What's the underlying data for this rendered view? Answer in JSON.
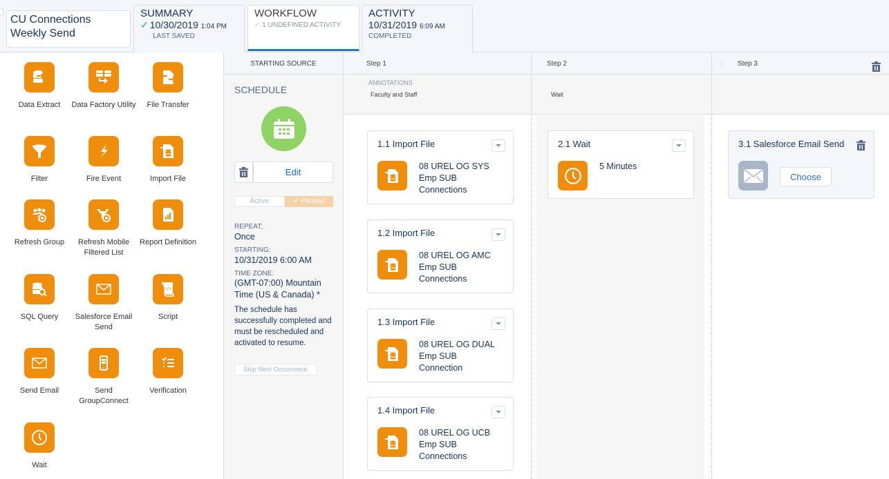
{
  "header": {
    "title": "CU Connections Weekly Send",
    "tabs": [
      {
        "title": "SUMMARY",
        "date": "10/30/2019",
        "time": "1:04 PM",
        "sub": "LAST SAVED",
        "icon": "check-icon"
      },
      {
        "title": "WORKFLOW",
        "sub": "1 UNDEFINED ACTIVITY",
        "icon": "undefined-activity-icon",
        "active": true
      },
      {
        "title": "ACTIVITY",
        "date": "10/31/2019",
        "time": "6:09 AM",
        "sub": "COMPLETED"
      }
    ]
  },
  "palette": {
    "items": [
      {
        "label": "Data Extract",
        "icon": "data-extract-icon"
      },
      {
        "label": "Data Factory Utility",
        "icon": "data-factory-icon"
      },
      {
        "label": "File Transfer",
        "icon": "file-transfer-icon"
      },
      {
        "label": "Filter",
        "icon": "filter-icon"
      },
      {
        "label": "Fire Event",
        "icon": "lightning-icon"
      },
      {
        "label": "Import File",
        "icon": "import-file-icon"
      },
      {
        "label": "Refresh Group",
        "icon": "refresh-group-icon"
      },
      {
        "label": "Refresh Mobile Filtered List",
        "icon": "refresh-mobile-list-icon"
      },
      {
        "label": "Report Definition",
        "icon": "report-icon"
      },
      {
        "label": "SQL Query",
        "icon": "sql-query-icon"
      },
      {
        "label": "Salesforce Email Send",
        "icon": "email-icon"
      },
      {
        "label": "Script",
        "icon": "script-icon"
      },
      {
        "label": "Send Email",
        "icon": "email-icon"
      },
      {
        "label": "Send GroupConnect",
        "icon": "mobile-icon"
      },
      {
        "label": "Verification",
        "icon": "checklist-icon"
      },
      {
        "label": "Wait",
        "icon": "clock-icon"
      }
    ]
  },
  "starting_source": {
    "header": "STARTING SOURCE",
    "title": "SCHEDULE",
    "edit_label": "Edit",
    "toggle": {
      "active_label": "Active",
      "paused_label": "Paused",
      "selected": "Paused"
    },
    "repeat_label": "REPEAT:",
    "repeat_value": "Once",
    "starting_label": "STARTING:",
    "starting_value": "10/31/2019 6:00 AM",
    "timezone_label": "TIME ZONE:",
    "timezone_value": "(GMT-07:00) Mountain Time (US & Canada) *",
    "message": "The schedule has successfully completed and must be rescheduled and activated to resume.",
    "skip_label": "Skip Next Occurrence"
  },
  "steps": [
    {
      "label": "Step 1",
      "annotations_label": "ANNOTATIONS",
      "annotation": "Faculty and Staff",
      "activities": [
        {
          "title": "1.1 Import File",
          "text": "08 UREL OG SYS Emp SUB Connections"
        },
        {
          "title": "1.2 Import File",
          "text": "08 UREL OG AMC Emp SUB Connections"
        },
        {
          "title": "1.3 Import File",
          "text": "08 UREL OG DUAL Emp SUB Connection"
        },
        {
          "title": "1.4 Import File",
          "text": "08 UREL OG UCB Emp SUB Connections"
        }
      ]
    },
    {
      "label": "Step 2",
      "annotation": "Wait",
      "activities": [
        {
          "title": "2.1 Wait",
          "text": "5 Minutes"
        }
      ]
    },
    {
      "label": "Step 3",
      "annotation": "",
      "activities": [
        {
          "title": "3.1 Salesforce Email Send",
          "button": "Choose"
        }
      ]
    }
  ],
  "colors": {
    "activity_orange": "#ef8d0c",
    "schedule_green": "#8ed363",
    "tab_active": "#2a73c5",
    "link_blue": "#0070d2"
  }
}
